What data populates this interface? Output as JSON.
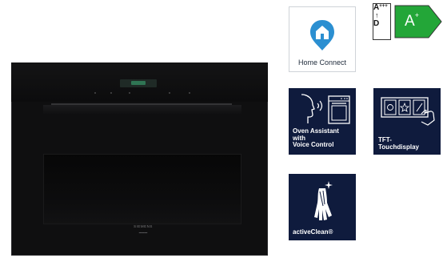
{
  "oven": {
    "brand_text": "SIEMENS"
  },
  "tiles": {
    "home_connect": {
      "label": "Home Connect"
    },
    "oven_assistant": {
      "label_lines": [
        "Oven Assistant",
        "with",
        "Voice Control"
      ]
    },
    "tft": {
      "label_lines": [
        "TFT-",
        "Touchdisplay"
      ]
    },
    "active_clean": {
      "label": "activeClean®"
    }
  },
  "energy_label": {
    "scale_top": "A",
    "scale_top_sup": "+++",
    "arrow": "↑",
    "scale_bottom": "D",
    "class_letter": "A",
    "class_sup": "+",
    "color": "#23a638"
  },
  "colors": {
    "tile_dark": "#0f1b3d",
    "home_connect_blue": "#2b8fd1"
  }
}
